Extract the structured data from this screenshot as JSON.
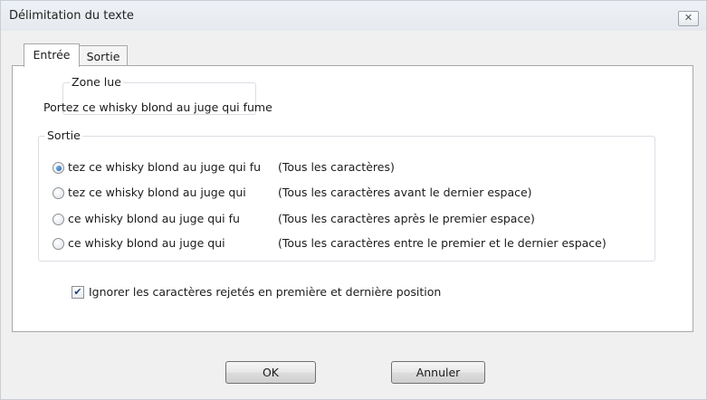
{
  "window": {
    "title": "Délimitation du texte",
    "close_glyph": "✕",
    "close_icon": "close-icon"
  },
  "tabs": [
    {
      "label": "Entrée",
      "active": true
    },
    {
      "label": "Sortie",
      "active": false
    }
  ],
  "zone_lue": {
    "legend": "Zone lue",
    "text": "Portez ce whisky blond au juge qui fume"
  },
  "sortie": {
    "legend": "Sortie",
    "options": [
      {
        "preview": "tez ce whisky blond au juge qui fu",
        "description": "(Tous les caractères)",
        "checked": true
      },
      {
        "preview": "tez ce whisky blond au juge qui",
        "description": "(Tous les caractères avant le dernier espace)",
        "checked": false
      },
      {
        "preview": "ce whisky blond au juge qui fu",
        "description": "(Tous les caractères après le premier espace)",
        "checked": false
      },
      {
        "preview": "ce whisky blond au juge qui",
        "description": "(Tous les caractères entre le premier et le dernier espace)",
        "checked": false
      }
    ]
  },
  "ignore_checkbox": {
    "label": "Ignorer les caractères rejetés en première et dernière position",
    "checked": true,
    "check_glyph": "✔"
  },
  "buttons": {
    "ok": "OK",
    "cancel": "Annuler"
  }
}
